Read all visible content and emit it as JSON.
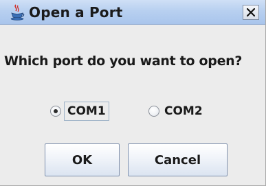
{
  "window": {
    "title": "Open a Port",
    "close_glyph": "X"
  },
  "dialog": {
    "prompt": "Which port do you want to open?",
    "options": [
      {
        "label": "COM1",
        "selected": true
      },
      {
        "label": "COM2",
        "selected": false
      }
    ],
    "buttons": {
      "ok": "OK",
      "cancel": "Cancel"
    }
  },
  "icons": {
    "title_icon": "java-coffee-cup-icon",
    "close_icon": "close-icon"
  },
  "colors": {
    "titlebar": "#b8d0f0",
    "dialog_background": "#ececec",
    "button_border": "#7d8fac"
  }
}
